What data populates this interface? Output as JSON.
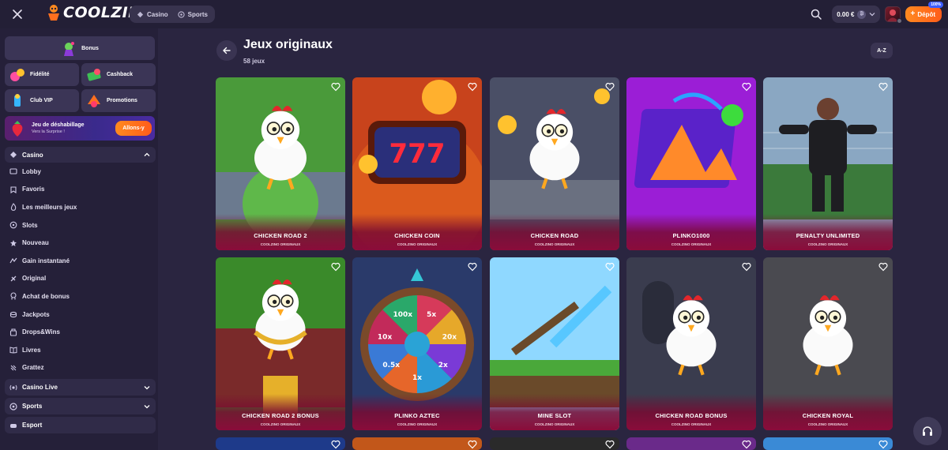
{
  "header": {
    "logo_text": "COOLZINO",
    "tabs": [
      {
        "label": "Casino",
        "icon": "casino-icon"
      },
      {
        "label": "Sports",
        "icon": "sports-ball-icon"
      }
    ],
    "balance": "0.00 €",
    "currency_symbol": "₿",
    "deposit_label": "Dépôt",
    "deposit_badge": "100%",
    "colors": {
      "accent": "#ff6f1e",
      "background": "#231f36"
    }
  },
  "sidebar": {
    "bonus_label": "Bonus",
    "promos": [
      {
        "label": "Fidélité"
      },
      {
        "label": "Cashback"
      },
      {
        "label": "Club VIP"
      },
      {
        "label": "Promotions"
      }
    ],
    "banner": {
      "title": "Jeu de déshabillage",
      "subtitle": "Vers la Surprise !",
      "button": "Allons-y"
    },
    "casino_section": "Casino",
    "casino_items": [
      {
        "label": "Lobby",
        "icon": "lobby-icon"
      },
      {
        "label": "Favoris",
        "icon": "favorites-icon"
      },
      {
        "label": "Les meilleurs jeux",
        "icon": "fire-icon"
      },
      {
        "label": "Slots",
        "icon": "slots-icon"
      },
      {
        "label": "Nouveau",
        "icon": "star-icon"
      },
      {
        "label": "Gain instantané",
        "icon": "instant-win-icon"
      },
      {
        "label": "Original",
        "icon": "original-icon"
      },
      {
        "label": "Achat de bonus",
        "icon": "bonus-buy-icon"
      },
      {
        "label": "Jackpots",
        "icon": "jackpot-icon"
      },
      {
        "label": "Drops&Wins",
        "icon": "drops-icon"
      },
      {
        "label": "Livres",
        "icon": "book-icon"
      },
      {
        "label": "Grattez",
        "icon": "scratch-icon"
      }
    ],
    "other_sections": [
      {
        "label": "Casino Live",
        "icon": "live-icon"
      },
      {
        "label": "Sports",
        "icon": "sports-ball-icon"
      },
      {
        "label": "Esport",
        "icon": "esport-icon"
      }
    ]
  },
  "main": {
    "title": "Jeux originaux",
    "count": "58 jeux",
    "sort_label": "A-Z",
    "games": [
      {
        "name": "CHICKEN ROAD 2",
        "provider": "COOLZINO ORIGINAUX",
        "theme": "chicken-green"
      },
      {
        "name": "CHICKEN COIN",
        "provider": "COOLZINO ORIGINAUX",
        "theme": "slot-777"
      },
      {
        "name": "CHICKEN ROAD",
        "provider": "COOLZINO ORIGINAUX",
        "theme": "chicken-coins"
      },
      {
        "name": "PLINKO1000",
        "provider": "COOLZINO ORIGINAUX",
        "theme": "plinko-purple"
      },
      {
        "name": "PENALTY UNLIMITED",
        "provider": "COOLZINO ORIGINAUX",
        "theme": "penalty"
      },
      {
        "name": "CHICKEN ROAD 2 BONUS",
        "provider": "COOLZINO ORIGINAUX",
        "theme": "chicken-gold"
      },
      {
        "name": "PLINKO AZTEC",
        "provider": "COOLZINO ORIGINAUX",
        "theme": "wheel"
      },
      {
        "name": "MINE SLOT",
        "provider": "COOLZINO ORIGINAUX",
        "theme": "mine"
      },
      {
        "name": "CHICKEN ROAD BONUS",
        "provider": "COOLZINO ORIGINAUX",
        "theme": "chicken-dark"
      },
      {
        "name": "CHICKEN ROYAL",
        "provider": "COOLZINO ORIGINAUX",
        "theme": "chicken-royal"
      }
    ],
    "wheel_labels": [
      "5x",
      "20x",
      "2x",
      "1x",
      "0.5x",
      "10x",
      "100x"
    ]
  }
}
